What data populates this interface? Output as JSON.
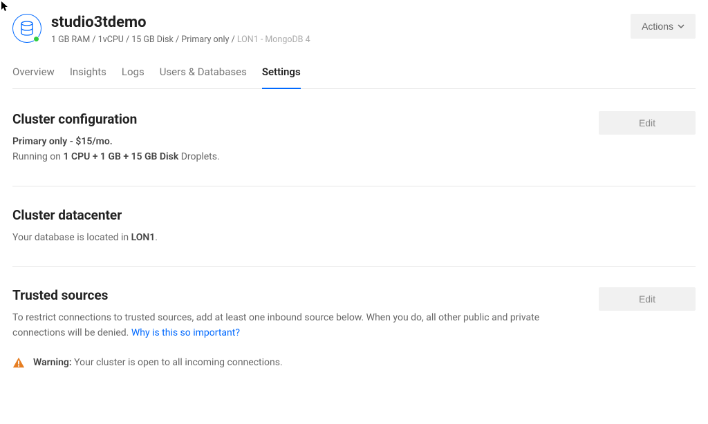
{
  "header": {
    "title": "studio3tdemo",
    "spec_ram": "1 GB RAM",
    "spec_cpu": "1vCPU",
    "spec_disk": "15 GB Disk",
    "spec_mode": "Primary only",
    "spec_region": "LON1",
    "spec_engine": "MongoDB 4",
    "sep": " / ",
    "dash": " - ",
    "actions_label": "Actions"
  },
  "tabs": {
    "overview": "Overview",
    "insights": "Insights",
    "logs": "Logs",
    "users": "Users & Databases",
    "settings": "Settings"
  },
  "cluster_config": {
    "title": "Cluster configuration",
    "plan": "Primary only - $15/mo.",
    "running_prefix": "Running on ",
    "running_specs": "1 CPU + 1 GB + 15 GB Disk",
    "running_suffix": " Droplets.",
    "edit_label": "Edit"
  },
  "datacenter": {
    "title": "Cluster datacenter",
    "text_prefix": "Your database is located in ",
    "region": "LON1",
    "text_suffix": "."
  },
  "trusted": {
    "title": "Trusted sources",
    "description": "To restrict connections to trusted sources, add at least one inbound source below. When you do, all other public and private connections will be denied. ",
    "link": "Why is this so important?",
    "edit_label": "Edit",
    "warning_label": "Warning:",
    "warning_text": " Your cluster is open to all incoming connections."
  }
}
